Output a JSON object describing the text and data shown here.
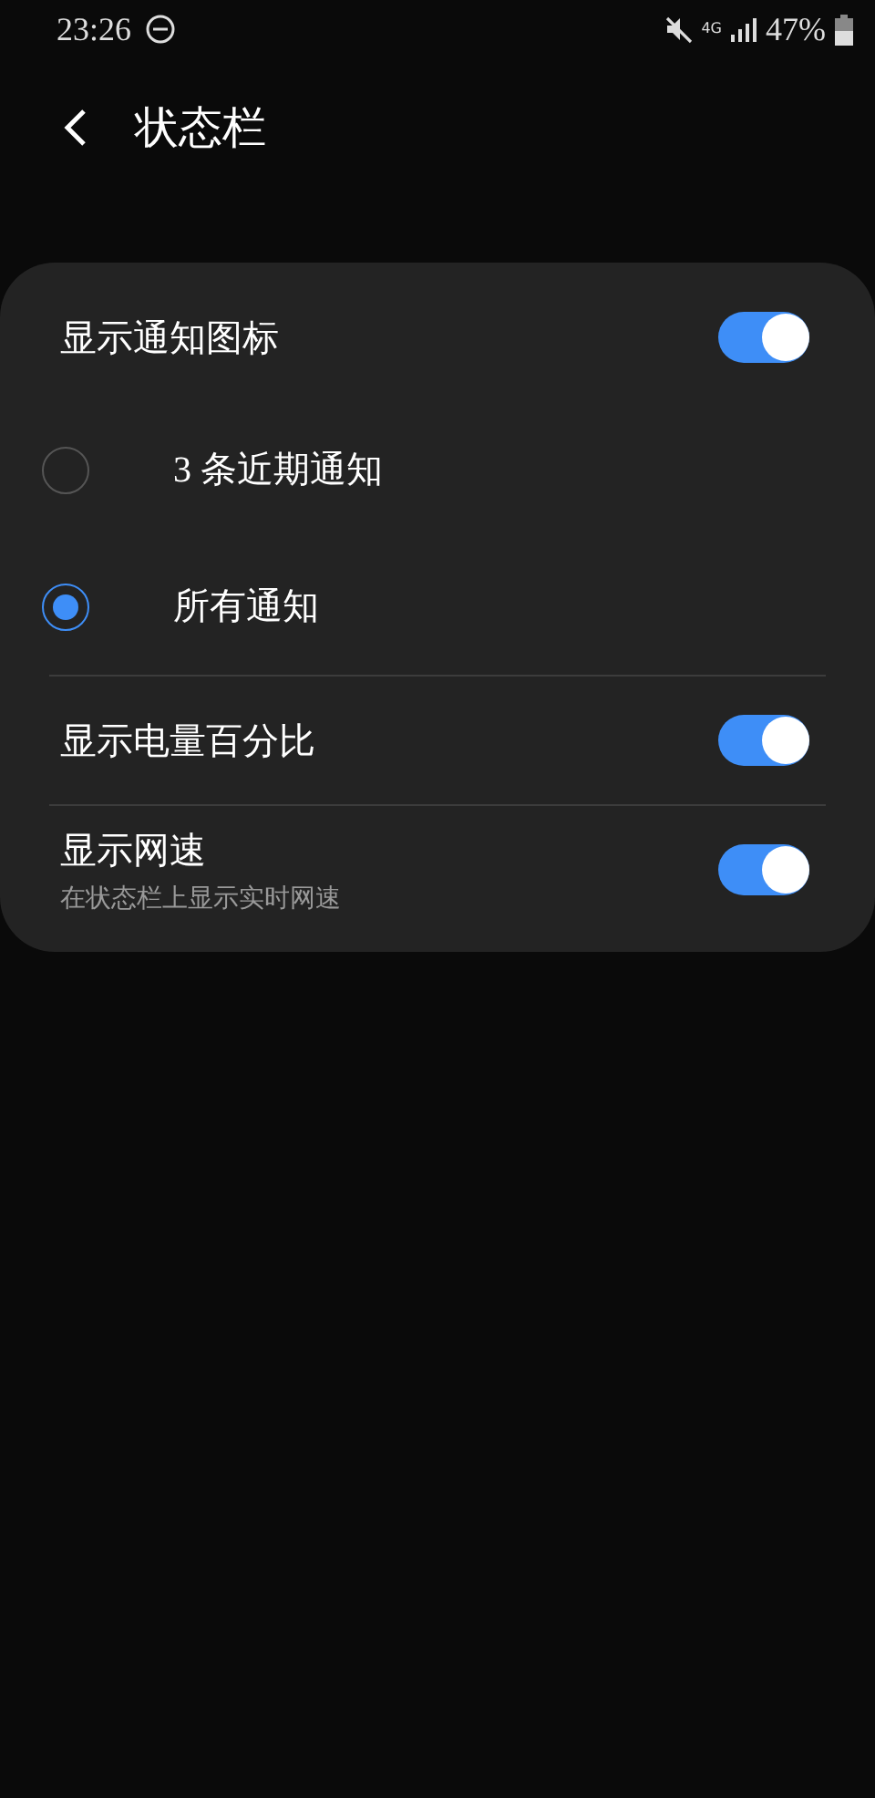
{
  "status_bar": {
    "time": "23:26",
    "network": "4G",
    "battery": "47%"
  },
  "header": {
    "title": "状态栏"
  },
  "settings": [
    {
      "kind": "switch",
      "label": "显示通知图标",
      "on": true
    },
    {
      "kind": "radio",
      "label": "3 条近期通知",
      "selected": false
    },
    {
      "kind": "radio",
      "label": "所有通知",
      "selected": true
    },
    {
      "kind": "switch",
      "label": "显示电量百分比",
      "on": true
    },
    {
      "kind": "switch",
      "label": "显示网速",
      "subtitle": "在状态栏上显示实时网速",
      "on": true
    }
  ]
}
